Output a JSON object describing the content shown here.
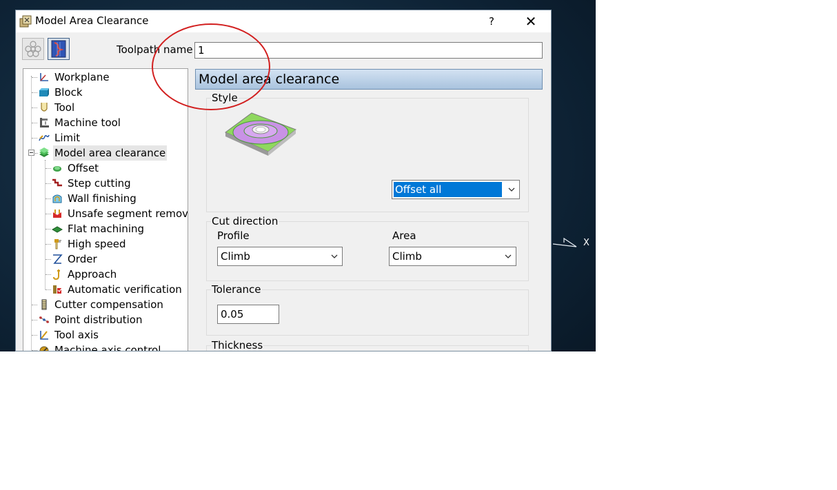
{
  "window": {
    "title": "Model Area Clearance",
    "help_glyph": "?",
    "close_glyph": "✕"
  },
  "toolpath": {
    "label": "Toolpath name",
    "value": "1"
  },
  "viewport": {
    "axis_label": "X"
  },
  "tree": {
    "items": [
      {
        "label": "Workplane",
        "icon": "workplane-icon"
      },
      {
        "label": "Block",
        "icon": "block-icon"
      },
      {
        "label": "Tool",
        "icon": "tool-icon"
      },
      {
        "label": "Machine tool",
        "icon": "machine-tool-icon"
      },
      {
        "label": "Limit",
        "icon": "limit-icon"
      },
      {
        "label": "Model area clearance",
        "icon": "model-area-clearance-icon",
        "selected": true
      },
      {
        "label": "Offset",
        "icon": "offset-icon"
      },
      {
        "label": "Step cutting",
        "icon": "step-cutting-icon"
      },
      {
        "label": "Wall finishing",
        "icon": "wall-finishing-icon"
      },
      {
        "label": "Unsafe segment removal",
        "icon": "unsafe-segment-icon"
      },
      {
        "label": "Flat machining",
        "icon": "flat-machining-icon"
      },
      {
        "label": "High speed",
        "icon": "high-speed-icon"
      },
      {
        "label": "Order",
        "icon": "order-icon"
      },
      {
        "label": "Approach",
        "icon": "approach-icon"
      },
      {
        "label": "Automatic verification",
        "icon": "automatic-verification-icon"
      },
      {
        "label": "Cutter compensation",
        "icon": "cutter-compensation-icon"
      },
      {
        "label": "Point distribution",
        "icon": "point-distribution-icon"
      },
      {
        "label": "Tool axis",
        "icon": "tool-axis-icon"
      },
      {
        "label": "Machine axis control",
        "icon": "machine-axis-control-icon"
      }
    ]
  },
  "panel": {
    "header": "Model area clearance",
    "style": {
      "label": "Style",
      "selected": "Offset all"
    },
    "cut_direction": {
      "label": "Cut direction",
      "profile_label": "Profile",
      "profile_value": "Climb",
      "area_label": "Area",
      "area_value": "Climb"
    },
    "tolerance": {
      "label": "Tolerance",
      "value": "0.05"
    },
    "thickness": {
      "label": "Thickness"
    }
  },
  "colors": {
    "selection": "#0078d7",
    "header_top": "#d3e2f2",
    "header_bottom": "#a9c3de",
    "annotation": "#d21f1f"
  }
}
